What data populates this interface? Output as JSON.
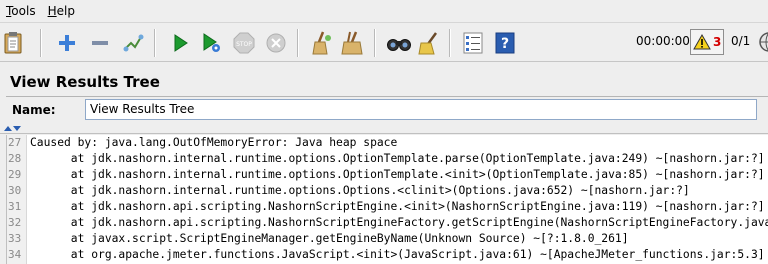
{
  "menu": {
    "tools": {
      "first": "T",
      "rest": "ools"
    },
    "help": {
      "first": "H",
      "rest": "elp"
    }
  },
  "toolbar": {
    "buttons": [
      {
        "icon": "clipboard-icon"
      },
      {
        "icon": "expand-icon"
      },
      {
        "icon": "collapse-icon"
      },
      {
        "icon": "toggle-icon"
      },
      {
        "icon": "start-icon"
      },
      {
        "icon": "start-no-pause-icon"
      },
      {
        "icon": "stop-icon"
      },
      {
        "icon": "shutdown-icon"
      },
      {
        "icon": "clear-icon"
      },
      {
        "icon": "clear-all-icon"
      },
      {
        "icon": "search-icon"
      },
      {
        "icon": "reset-search-icon"
      },
      {
        "icon": "function-helper-icon"
      },
      {
        "icon": "help-icon"
      }
    ],
    "timer": "00:00:00",
    "warning_count": "3",
    "threads": "0/1"
  },
  "panel": {
    "title": "View Results Tree",
    "name_label": "Name:",
    "name_value": "View Results Tree"
  },
  "log": {
    "lines": [
      {
        "num": "27",
        "text": "Caused by: java.lang.OutOfMemoryError: Java heap space"
      },
      {
        "num": "28",
        "text": "      at jdk.nashorn.internal.runtime.options.OptionTemplate.parse(OptionTemplate.java:249) ~[nashorn.jar:?]"
      },
      {
        "num": "29",
        "text": "      at jdk.nashorn.internal.runtime.options.OptionTemplate.<init>(OptionTemplate.java:85) ~[nashorn.jar:?]"
      },
      {
        "num": "30",
        "text": "      at jdk.nashorn.internal.runtime.options.Options.<clinit>(Options.java:652) ~[nashorn.jar:?]"
      },
      {
        "num": "31",
        "text": "      at jdk.nashorn.api.scripting.NashornScriptEngine.<init>(NashornScriptEngine.java:119) ~[nashorn.jar:?]"
      },
      {
        "num": "32",
        "text": "      at jdk.nashorn.api.scripting.NashornScriptEngineFactory.getScriptEngine(NashornScriptEngineFactory.java"
      },
      {
        "num": "33",
        "text": "      at javax.script.ScriptEngineManager.getEngineByName(Unknown Source) ~[?:1.8.0_261]"
      },
      {
        "num": "34",
        "text": "      at org.apache.jmeter.functions.JavaScript.<init>(JavaScript.java:61) ~[ApacheJMeter_functions.jar:5.3]"
      }
    ]
  }
}
